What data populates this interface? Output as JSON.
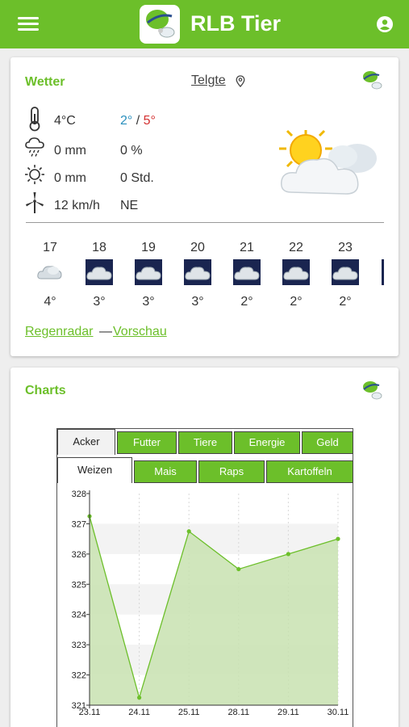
{
  "appbar": {
    "title": "RLB Tier",
    "color": "#6cbf2a"
  },
  "weather": {
    "title": "Wetter",
    "location": "Telgte",
    "temperature": "4°C",
    "temp_min": "2°",
    "temp_sep": "/",
    "temp_max": "5°",
    "rain": "0 mm",
    "rain_prob": "0 %",
    "sun": "0 mm",
    "sun_hours": "0 Std.",
    "wind_speed": "12 km/h",
    "wind_dir": "NE",
    "forecast": [
      {
        "day": "17",
        "temp": "4°",
        "icon": "cloud-icon"
      },
      {
        "day": "18",
        "temp": "3°",
        "icon": "night-cloud-icon"
      },
      {
        "day": "19",
        "temp": "3°",
        "icon": "night-cloud-icon"
      },
      {
        "day": "20",
        "temp": "3°",
        "icon": "night-cloud-icon"
      },
      {
        "day": "21",
        "temp": "2°",
        "icon": "night-cloud-icon"
      },
      {
        "day": "22",
        "temp": "2°",
        "icon": "night-cloud-icon"
      },
      {
        "day": "23",
        "temp": "2°",
        "icon": "night-cloud-icon"
      }
    ],
    "link_radar": "Regenradar",
    "link_sep": "—",
    "link_preview": "Vorschau"
  },
  "charts": {
    "title": "Charts",
    "tabs_top": [
      "Acker",
      "Futter",
      "Tiere",
      "Energie",
      "Geld"
    ],
    "tabs_sub": [
      "Weizen",
      "Mais",
      "Raps",
      "Kartoffeln"
    ],
    "active_top": "Acker",
    "active_sub": "Weizen"
  },
  "chart_data": {
    "type": "area",
    "title": "",
    "xlabel": "",
    "ylabel": "",
    "x": [
      "23.11",
      "24.11",
      "25.11",
      "28.11",
      "29.11",
      "30.11"
    ],
    "values": [
      327.25,
      321.25,
      326.75,
      325.5,
      326.0,
      326.5
    ],
    "ylim": [
      321,
      328
    ],
    "yticks": [
      "321",
      "322",
      "323",
      "324",
      "325",
      "326",
      "327",
      "328"
    ],
    "grid": true,
    "fill_color": "#c8e2b0",
    "line_color": "#6cbf2a"
  }
}
